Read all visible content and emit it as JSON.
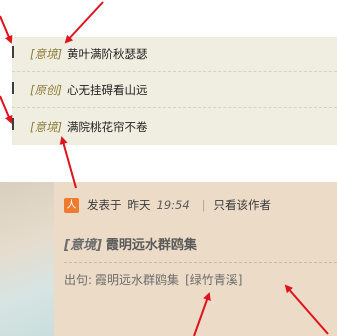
{
  "list": {
    "rows": [
      {
        "tag": "[意境]",
        "title": "黄叶满阶秋瑟瑟"
      },
      {
        "tag": "[原创]",
        "title": "心无挂碍看山远"
      },
      {
        "tag": "[意境]",
        "title": "满院桃花帘不卷"
      }
    ]
  },
  "post": {
    "icon_label": "人",
    "posted_label": "发表于",
    "day": "昨天",
    "time": "19:54",
    "separator": "|",
    "only_author_label": "只看该作者",
    "title_tag": "[意境]",
    "title": "霞明远水群鸥集",
    "source_label": "出句:",
    "source_value": "霞明远水群鸥集",
    "author": "[绿竹青溪]"
  },
  "colors": {
    "annotation_arrow": "#e0121c",
    "list_bg": "#f0eee0",
    "post_bg": "#ecdbc7",
    "tag_color": "#8e7c3a"
  }
}
